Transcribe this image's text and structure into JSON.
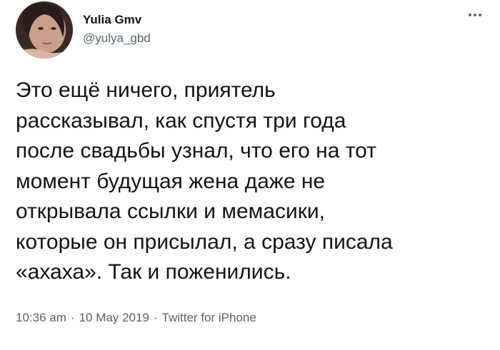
{
  "author": {
    "display_name": "Yulia Gmv",
    "handle": "@yulya_gbd",
    "avatar_icon": "profile-photo"
  },
  "more_icon": "ellipsis-icon",
  "tweet": {
    "lines": [
      "Это ещё ничего, приятель",
      "рассказывал, как спустя три года",
      "после свадьбы узнал, что его на тот",
      "момент будущая жена даже не",
      "открывала ссылки и мемасики,",
      "которые он присылал, а сразу писала",
      "«ахаха». Так и поженились."
    ]
  },
  "meta": {
    "time": "10:36 am",
    "date": "10 May 2019",
    "separator": "·",
    "source": "Twitter for iPhone"
  },
  "colors": {
    "text_primary": "#0f1419",
    "text_secondary": "#536471",
    "background": "#ffffff"
  }
}
